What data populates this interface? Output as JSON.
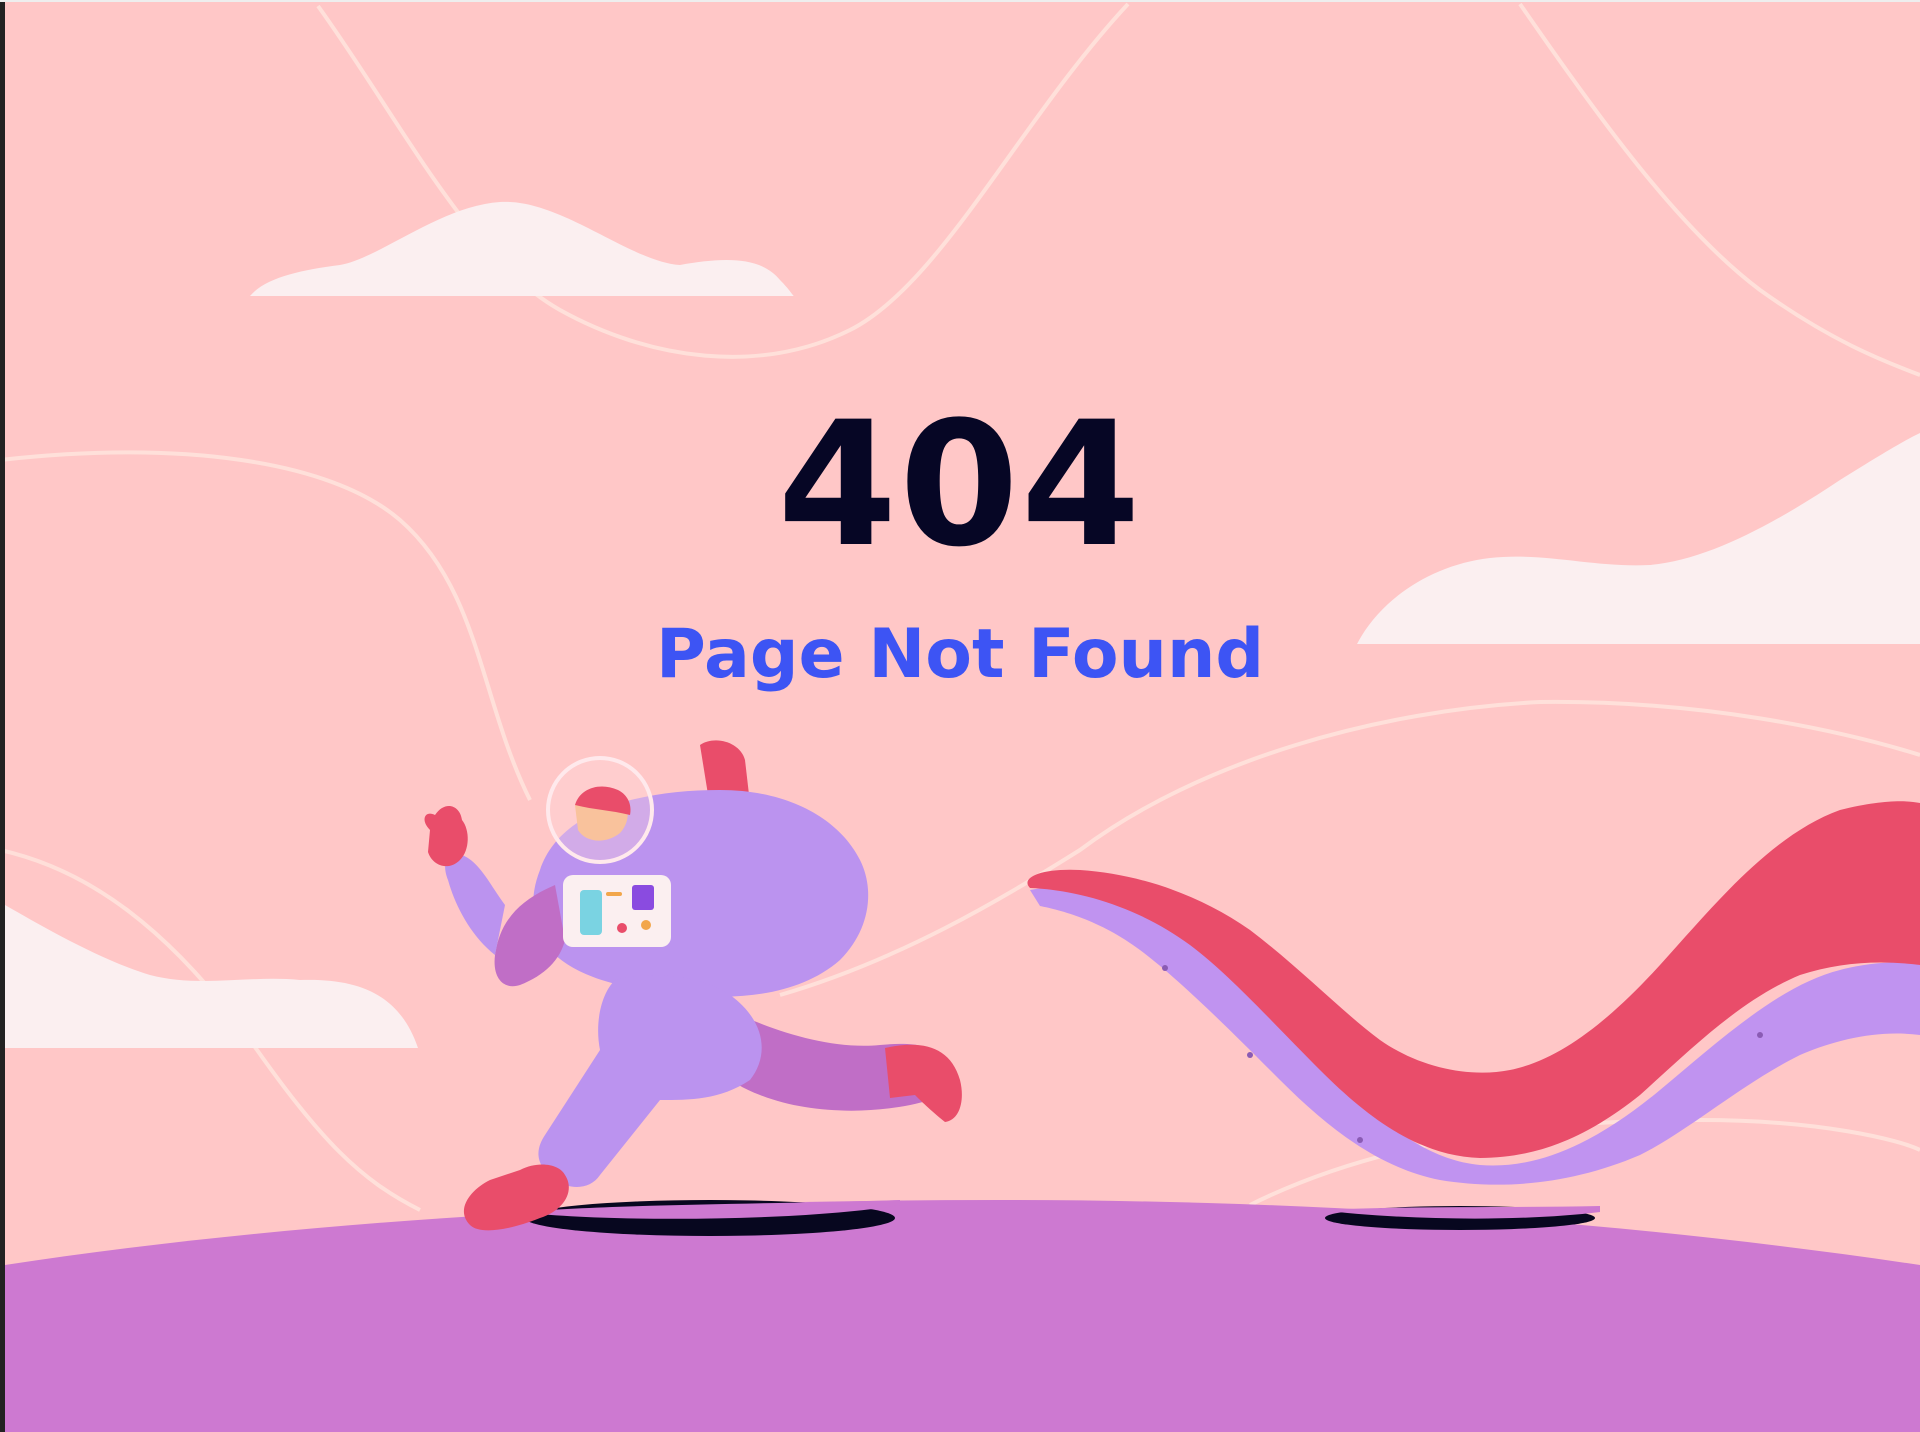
{
  "page": {
    "error_code": "404",
    "error_message": "Page Not Found"
  },
  "illustration": {
    "subject": "astronaut-running-from-tentacle",
    "colors": {
      "background": "#ffc7c7",
      "ground": "#cd79d1",
      "cloud": "#fbeff0",
      "tentacle": "#e94d6a",
      "tentacle_underside": "#c093f0",
      "suit": "#bb93ef",
      "suit_shade": "#c06ec6",
      "boots_gloves": "#e94d6a",
      "shadow": "#07071f",
      "title": "#060625",
      "message": "#3d54f4"
    }
  }
}
